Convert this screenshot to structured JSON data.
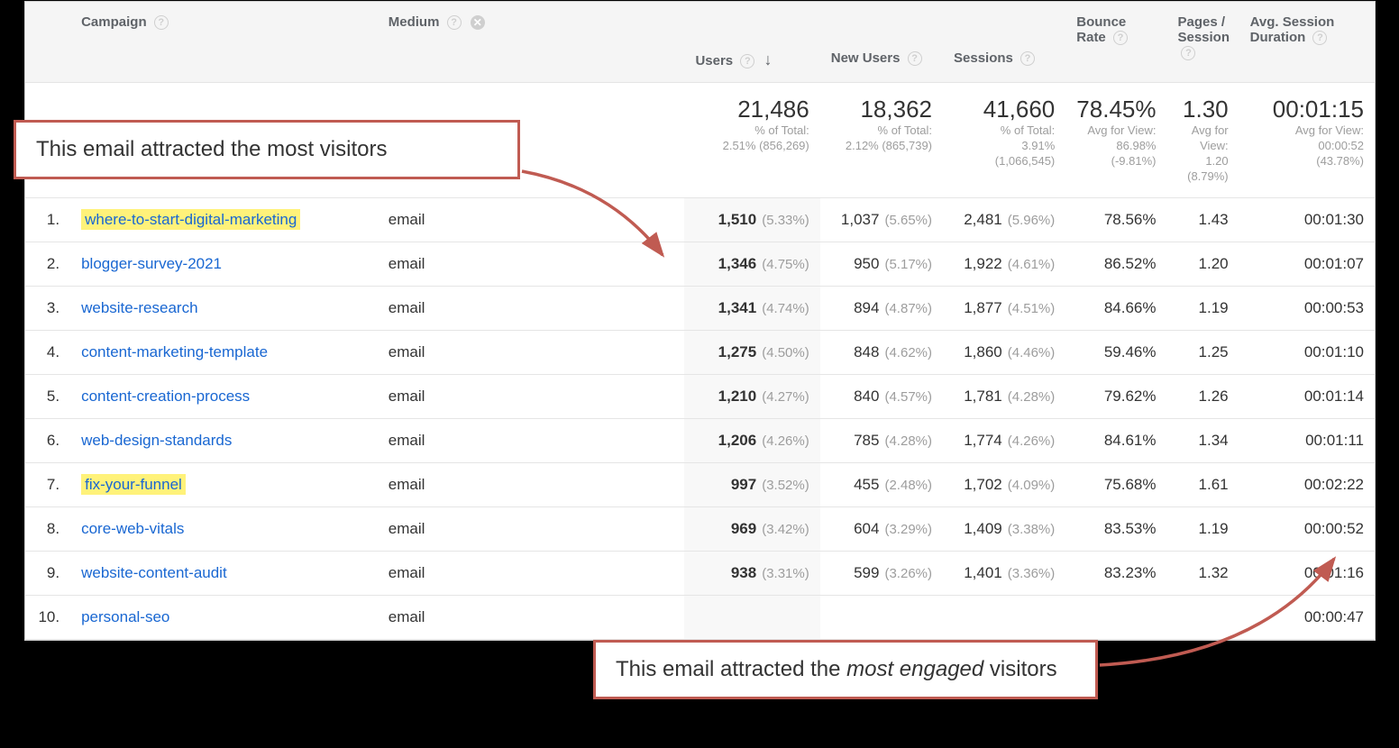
{
  "headers": {
    "campaign": "Campaign",
    "medium": "Medium",
    "users": "Users",
    "new_users": "New Users",
    "sessions": "Sessions",
    "bounce_rate": "Bounce Rate",
    "pages_session": "Pages / Session",
    "avg_session_duration": "Avg. Session Duration"
  },
  "totals": {
    "users_value": "21,486",
    "users_sub1": "% of Total:",
    "users_sub2": "2.51% (856,269)",
    "new_users_value": "18,362",
    "new_users_sub1": "% of Total:",
    "new_users_sub2": "2.12% (865,739)",
    "sessions_value": "41,660",
    "sessions_sub1": "% of Total:",
    "sessions_sub2": "3.91%",
    "sessions_sub3": "(1,066,545)",
    "bounce_value": "78.45%",
    "bounce_sub1": "Avg for View:",
    "bounce_sub2": "86.98%",
    "bounce_sub3": "(-9.81%)",
    "pps_value": "1.30",
    "pps_sub1": "Avg for",
    "pps_sub2": "View:",
    "pps_sub3": "1.20",
    "pps_sub4": "(8.79%)",
    "dur_value": "00:01:15",
    "dur_sub1": "Avg for View:",
    "dur_sub2": "00:00:52",
    "dur_sub3": "(43.78%)"
  },
  "rows": [
    {
      "idx": "1.",
      "campaign": "where-to-start-digital-marketing",
      "medium": "email",
      "users": "1,510",
      "users_pct": "(5.33%)",
      "new_users": "1,037",
      "new_pct": "(5.65%)",
      "sessions": "2,481",
      "sess_pct": "(5.96%)",
      "bounce": "78.56%",
      "pps": "1.43",
      "dur": "00:01:30",
      "hl": true
    },
    {
      "idx": "2.",
      "campaign": "blogger-survey-2021",
      "medium": "email",
      "users": "1,346",
      "users_pct": "(4.75%)",
      "new_users": "950",
      "new_pct": "(5.17%)",
      "sessions": "1,922",
      "sess_pct": "(4.61%)",
      "bounce": "86.52%",
      "pps": "1.20",
      "dur": "00:01:07",
      "hl": false
    },
    {
      "idx": "3.",
      "campaign": "website-research",
      "medium": "email",
      "users": "1,341",
      "users_pct": "(4.74%)",
      "new_users": "894",
      "new_pct": "(4.87%)",
      "sessions": "1,877",
      "sess_pct": "(4.51%)",
      "bounce": "84.66%",
      "pps": "1.19",
      "dur": "00:00:53",
      "hl": false
    },
    {
      "idx": "4.",
      "campaign": "content-marketing-template",
      "medium": "email",
      "users": "1,275",
      "users_pct": "(4.50%)",
      "new_users": "848",
      "new_pct": "(4.62%)",
      "sessions": "1,860",
      "sess_pct": "(4.46%)",
      "bounce": "59.46%",
      "pps": "1.25",
      "dur": "00:01:10",
      "hl": false
    },
    {
      "idx": "5.",
      "campaign": "content-creation-process",
      "medium": "email",
      "users": "1,210",
      "users_pct": "(4.27%)",
      "new_users": "840",
      "new_pct": "(4.57%)",
      "sessions": "1,781",
      "sess_pct": "(4.28%)",
      "bounce": "79.62%",
      "pps": "1.26",
      "dur": "00:01:14",
      "hl": false
    },
    {
      "idx": "6.",
      "campaign": "web-design-standards",
      "medium": "email",
      "users": "1,206",
      "users_pct": "(4.26%)",
      "new_users": "785",
      "new_pct": "(4.28%)",
      "sessions": "1,774",
      "sess_pct": "(4.26%)",
      "bounce": "84.61%",
      "pps": "1.34",
      "dur": "00:01:11",
      "hl": false
    },
    {
      "idx": "7.",
      "campaign": "fix-your-funnel",
      "medium": "email",
      "users": "997",
      "users_pct": "(3.52%)",
      "new_users": "455",
      "new_pct": "(2.48%)",
      "sessions": "1,702",
      "sess_pct": "(4.09%)",
      "bounce": "75.68%",
      "pps": "1.61",
      "dur": "00:02:22",
      "hl": true
    },
    {
      "idx": "8.",
      "campaign": "core-web-vitals",
      "medium": "email",
      "users": "969",
      "users_pct": "(3.42%)",
      "new_users": "604",
      "new_pct": "(3.29%)",
      "sessions": "1,409",
      "sess_pct": "(3.38%)",
      "bounce": "83.53%",
      "pps": "1.19",
      "dur": "00:00:52",
      "hl": false
    },
    {
      "idx": "9.",
      "campaign": "website-content-audit",
      "medium": "email",
      "users": "938",
      "users_pct": "(3.31%)",
      "new_users": "599",
      "new_pct": "(3.26%)",
      "sessions": "1,401",
      "sess_pct": "(3.36%)",
      "bounce": "83.23%",
      "pps": "1.32",
      "dur": "00:01:16",
      "hl": false
    },
    {
      "idx": "10.",
      "campaign": "personal-seo",
      "medium": "email",
      "users": "",
      "users_pct": "",
      "new_users": "",
      "new_pct": "",
      "sessions": "",
      "sess_pct": "",
      "bounce": "",
      "pps": "",
      "dur": "00:00:47",
      "hl": false
    }
  ],
  "callouts": {
    "top": "This email attracted the most visitors",
    "bottom_pre": "This email attracted the ",
    "bottom_em": "most engaged",
    "bottom_post": " visitors"
  }
}
